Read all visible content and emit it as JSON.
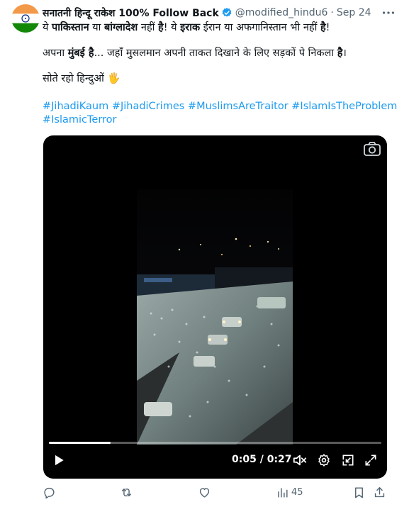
{
  "post": {
    "display_name": "सनातनी हिन्दू राकेश 100% Follow Back",
    "handle": "@modified_hindu6",
    "separator": "·",
    "time": "Sep 24",
    "line1": {
      "p1": "ये ",
      "p2": "पाकिस्तान",
      "p3": " या ",
      "p4": "बांग्लादेश",
      "p5": " नहीं ",
      "p6": "है",
      "p7": "! ये ",
      "p8": "इराक",
      "p9": " ईरान या अफगानिस्तान भी नहीं ",
      "p10": "है",
      "p11": "!"
    },
    "line2": {
      "p1": "अपना ",
      "p2": "मुंबई है",
      "p3": "... जहाँ मुसलमान अपनी ताकत दिखाने के लिए सड़कों पे निकला ",
      "p4": "है",
      "p5": "।"
    },
    "line3": "सोते रहो हिन्दुओं 🖐",
    "hashtags_line1": [
      "#JihadiKaum",
      "#JihadiCrimes",
      "#MuslimsAreTraitor",
      "#IslamIsTheProblem"
    ],
    "hashtags_line2": [
      "#IslamicTerror"
    ]
  },
  "video": {
    "current_time": "0:05",
    "separator": " / ",
    "duration": "0:27",
    "progress_fraction": 0.185
  },
  "actions": {
    "views": "45"
  },
  "icons": {
    "verified": "verified-badge-icon",
    "more": "more-icon",
    "camera": "camera-icon",
    "play": "play-icon",
    "mute": "mute-icon",
    "settings": "settings-icon",
    "pip": "picture-in-picture-icon",
    "fullscreen": "fullscreen-icon",
    "reply": "reply-icon",
    "retweet": "retweet-icon",
    "like": "like-icon",
    "views": "views-icon",
    "bookmark": "bookmark-icon",
    "share": "share-icon"
  },
  "colors": {
    "accent": "#1d9bf0",
    "muted": "#536471",
    "text": "#0f1419"
  }
}
